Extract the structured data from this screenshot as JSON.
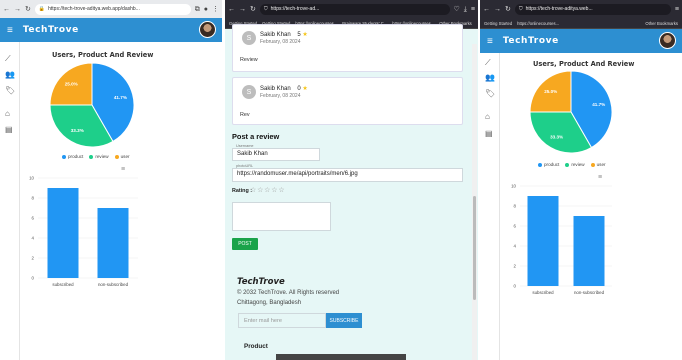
{
  "window1": {
    "url": "https://tech-trove-aditya.web.app/dashb...",
    "brand": "TechTrove",
    "pie": {
      "title": "Users, Product And Review",
      "slices": [
        {
          "label": "product",
          "pct_label": "41.7%",
          "value": 41.7,
          "color": "#2196f3"
        },
        {
          "label": "review",
          "pct_label": "33.3%",
          "value": 33.3,
          "color": "#1ecf8a"
        },
        {
          "label": "user",
          "pct_label": "25.0%",
          "value": 25.0,
          "color": "#f7a820"
        }
      ]
    },
    "bar": {
      "categories": [
        "subscribed",
        "non-subscribed"
      ],
      "values": [
        9,
        7
      ],
      "yticks": [
        "0",
        "2",
        "4",
        "6",
        "8",
        "10"
      ],
      "ymax": 10,
      "color": "#2196f3",
      "menu_icon": "menu-icon"
    }
  },
  "window2": {
    "url": "https://tech-trove-ad...",
    "bookmarks": [
      "Getting Started",
      "Getting Started",
      "https://onlinecourses...",
      "Brainware Students' C...",
      "https://onlinecourses...",
      "Other Bookmarks"
    ],
    "reviews": [
      {
        "avatar_letter": "S",
        "name": "Sakib Khan",
        "rating": "5",
        "date": "February, 08 2024",
        "body": "Review"
      },
      {
        "avatar_letter": "S",
        "name": "Sakib Khan",
        "rating": "0",
        "date": "February, 08 2024",
        "body": "Rev"
      }
    ],
    "form": {
      "heading": "Post a review",
      "username_label": "Username",
      "username_value": "Sakib Khan",
      "photo_label": "photoURL",
      "photo_value": "https://randomuser.me/api/portraits/men/6.jpg",
      "rating_label": "Rating :",
      "stars": "☆☆☆☆☆",
      "post_label": "POST"
    },
    "footer": {
      "brand": "TechTrove",
      "copyright": "© 2032 TechTrove. All Rights reserved",
      "location": "Chittagong, Bangladesh",
      "email_placeholder": "Enter mail here",
      "subscribe_label": "SUBSCRIBE",
      "product_heading": "Product"
    }
  },
  "window3": {
    "url": "https://tech-trove-aditya.web...",
    "bookmarks": [
      "Getting Started",
      "https://onlinecourses...",
      "Other Bookmarks"
    ],
    "brand": "TechTrove",
    "pie": {
      "title": "Users, Product And Review",
      "slices": [
        {
          "label": "product",
          "pct_label": "41.7%",
          "value": 41.7,
          "color": "#2196f3"
        },
        {
          "label": "review",
          "pct_label": "33.3%",
          "value": 33.3,
          "color": "#1ecf8a"
        },
        {
          "label": "user",
          "pct_label": "25.0%",
          "value": 25.0,
          "color": "#f7a820"
        }
      ]
    },
    "bar": {
      "categories": [
        "subscribed",
        "non-subscribed"
      ],
      "values": [
        9,
        7
      ],
      "yticks": [
        "0",
        "2",
        "4",
        "6",
        "8",
        "10"
      ],
      "ymax": 10,
      "color": "#2196f3"
    }
  }
}
